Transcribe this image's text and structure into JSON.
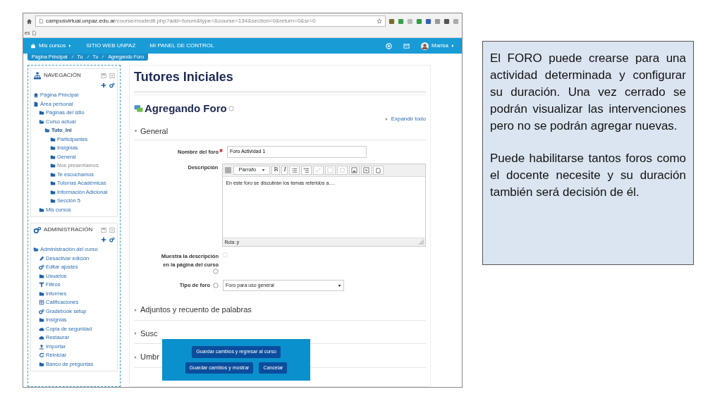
{
  "browser": {
    "url_host": "campusvirtual.unpaz.edu.ar",
    "url_path": "/course/modedit.php?add=forum&type=&course=134&section=0&return=0&sr=0",
    "bookmarks_label": "es"
  },
  "navbar": {
    "items": [
      {
        "label": "Mis cursos",
        "kind": "menu"
      },
      {
        "label": "SITIO WEB UNPAZ",
        "kind": "link"
      },
      {
        "label": "MI PANEL DE CONTROL",
        "kind": "link"
      }
    ],
    "user": "Marisa"
  },
  "breadcrumb": [
    "Página Principal",
    "Tu",
    "Tu",
    "Agregando Foro"
  ],
  "navigation": {
    "title": "NAVEGACIÓN",
    "items": [
      {
        "label": "Página Principal",
        "kind": "home"
      },
      {
        "label": "Área personal",
        "kind": "file",
        "children": [
          {
            "label": "Páginas del sitio",
            "kind": "folder"
          },
          {
            "label": "Curso actual",
            "kind": "folder-open",
            "children": [
              {
                "label": "Tuto_Ini",
                "kind": "folder-open",
                "current": true,
                "children": [
                  {
                    "label": "Participantes",
                    "kind": "folder"
                  },
                  {
                    "label": "Insignias",
                    "kind": "folder"
                  },
                  {
                    "label": "General",
                    "kind": "folder"
                  },
                  {
                    "label": "Nos presentamos",
                    "kind": "folder",
                    "dimmed": true
                  },
                  {
                    "label": "Te escuchamos",
                    "kind": "folder"
                  },
                  {
                    "label": "Tutorías Académicas",
                    "kind": "folder"
                  },
                  {
                    "label": "Información Adicional",
                    "kind": "folder"
                  },
                  {
                    "label": "Sección 5",
                    "kind": "folder"
                  }
                ]
              }
            ]
          },
          {
            "label": "Mis cursos",
            "kind": "folder"
          }
        ]
      }
    ]
  },
  "administration": {
    "title": "ADMINISTRACIÓN",
    "items": [
      {
        "label": "Administración del curso",
        "kind": "folder-open",
        "children": [
          {
            "label": "Desactivar edición",
            "kind": "pencil"
          },
          {
            "label": "Editar ajustes",
            "kind": "gear"
          },
          {
            "label": "Usuarios",
            "kind": "folder"
          },
          {
            "label": "Filtros",
            "kind": "filter"
          },
          {
            "label": "Informes",
            "kind": "folder"
          },
          {
            "label": "Calificaciones",
            "kind": "table"
          },
          {
            "label": "Gradebook setup",
            "kind": "gear"
          },
          {
            "label": "Insignias",
            "kind": "folder"
          },
          {
            "label": "Copia de seguridad",
            "kind": "cloud"
          },
          {
            "label": "Restaurar",
            "kind": "cloud"
          },
          {
            "label": "Importar",
            "kind": "upload"
          },
          {
            "label": "Reiniciar",
            "kind": "reset"
          },
          {
            "label": "Banco de preguntas",
            "kind": "folder"
          }
        ]
      }
    ]
  },
  "main": {
    "course_title": "Tutores Iniciales",
    "page_title": "Agregando Foro",
    "expand_all": "Expandir todo",
    "sections": [
      {
        "title": "General",
        "expanded": true
      },
      {
        "title": "Adjuntos y recuento de palabras",
        "expanded": false
      },
      {
        "title": "Susc",
        "expanded": false
      },
      {
        "title": "Umbr",
        "expanded": false
      }
    ],
    "forum_name": {
      "label": "Nombre del foro",
      "required": true,
      "value": "Foro Actividad 1"
    },
    "description": {
      "label": "Descripción",
      "format": "Párrafo",
      "bold": "B",
      "italic": "I",
      "text": "En este foro se discutirán los temas referidos a….",
      "path": "Ruta: p"
    },
    "show_description": {
      "label": "Muestra la descripción en la página del curso",
      "checked": false
    },
    "forum_type": {
      "label": "Tipo de foro",
      "value": "Foro para uso general"
    },
    "buttons": [
      "Guardar cambios y regresar al curso",
      "Guardar cambios y mostrar",
      "Cancelar"
    ]
  },
  "note": [
    "El FORO puede crearse para una actividad determinada y configurar su duración. Una vez cerrado se podrán visualizar las intervenciones pero no se podrán agregar nuevas.",
    "Puede habilitarse tantos foros como el docente necesite y su duración también será decisión de él."
  ]
}
